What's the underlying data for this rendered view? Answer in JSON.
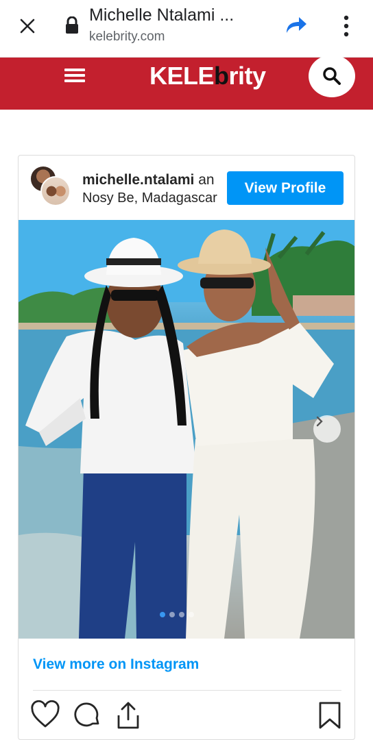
{
  "browser": {
    "title": "Michelle Ntalami ...",
    "url": "kelebrity.com",
    "icons": [
      "close-icon",
      "lock-icon",
      "share-icon",
      "more-vert-icon"
    ]
  },
  "site": {
    "logo_part1": "KELE",
    "logo_part2": "b",
    "logo_part3": "rity",
    "brand_color": "#c3202e"
  },
  "embed": {
    "username": "michelle.ntalami",
    "username_suffix": " an",
    "location": "Nosy Be, Madagascar",
    "view_profile_label": "View Profile",
    "view_more_label": "View more on Instagram",
    "accent_color": "#0095f6",
    "carousel": {
      "active_index": 0,
      "count": 4
    },
    "actions": [
      "heart-icon",
      "comment-icon",
      "share-icon",
      "bookmark-icon"
    ]
  }
}
